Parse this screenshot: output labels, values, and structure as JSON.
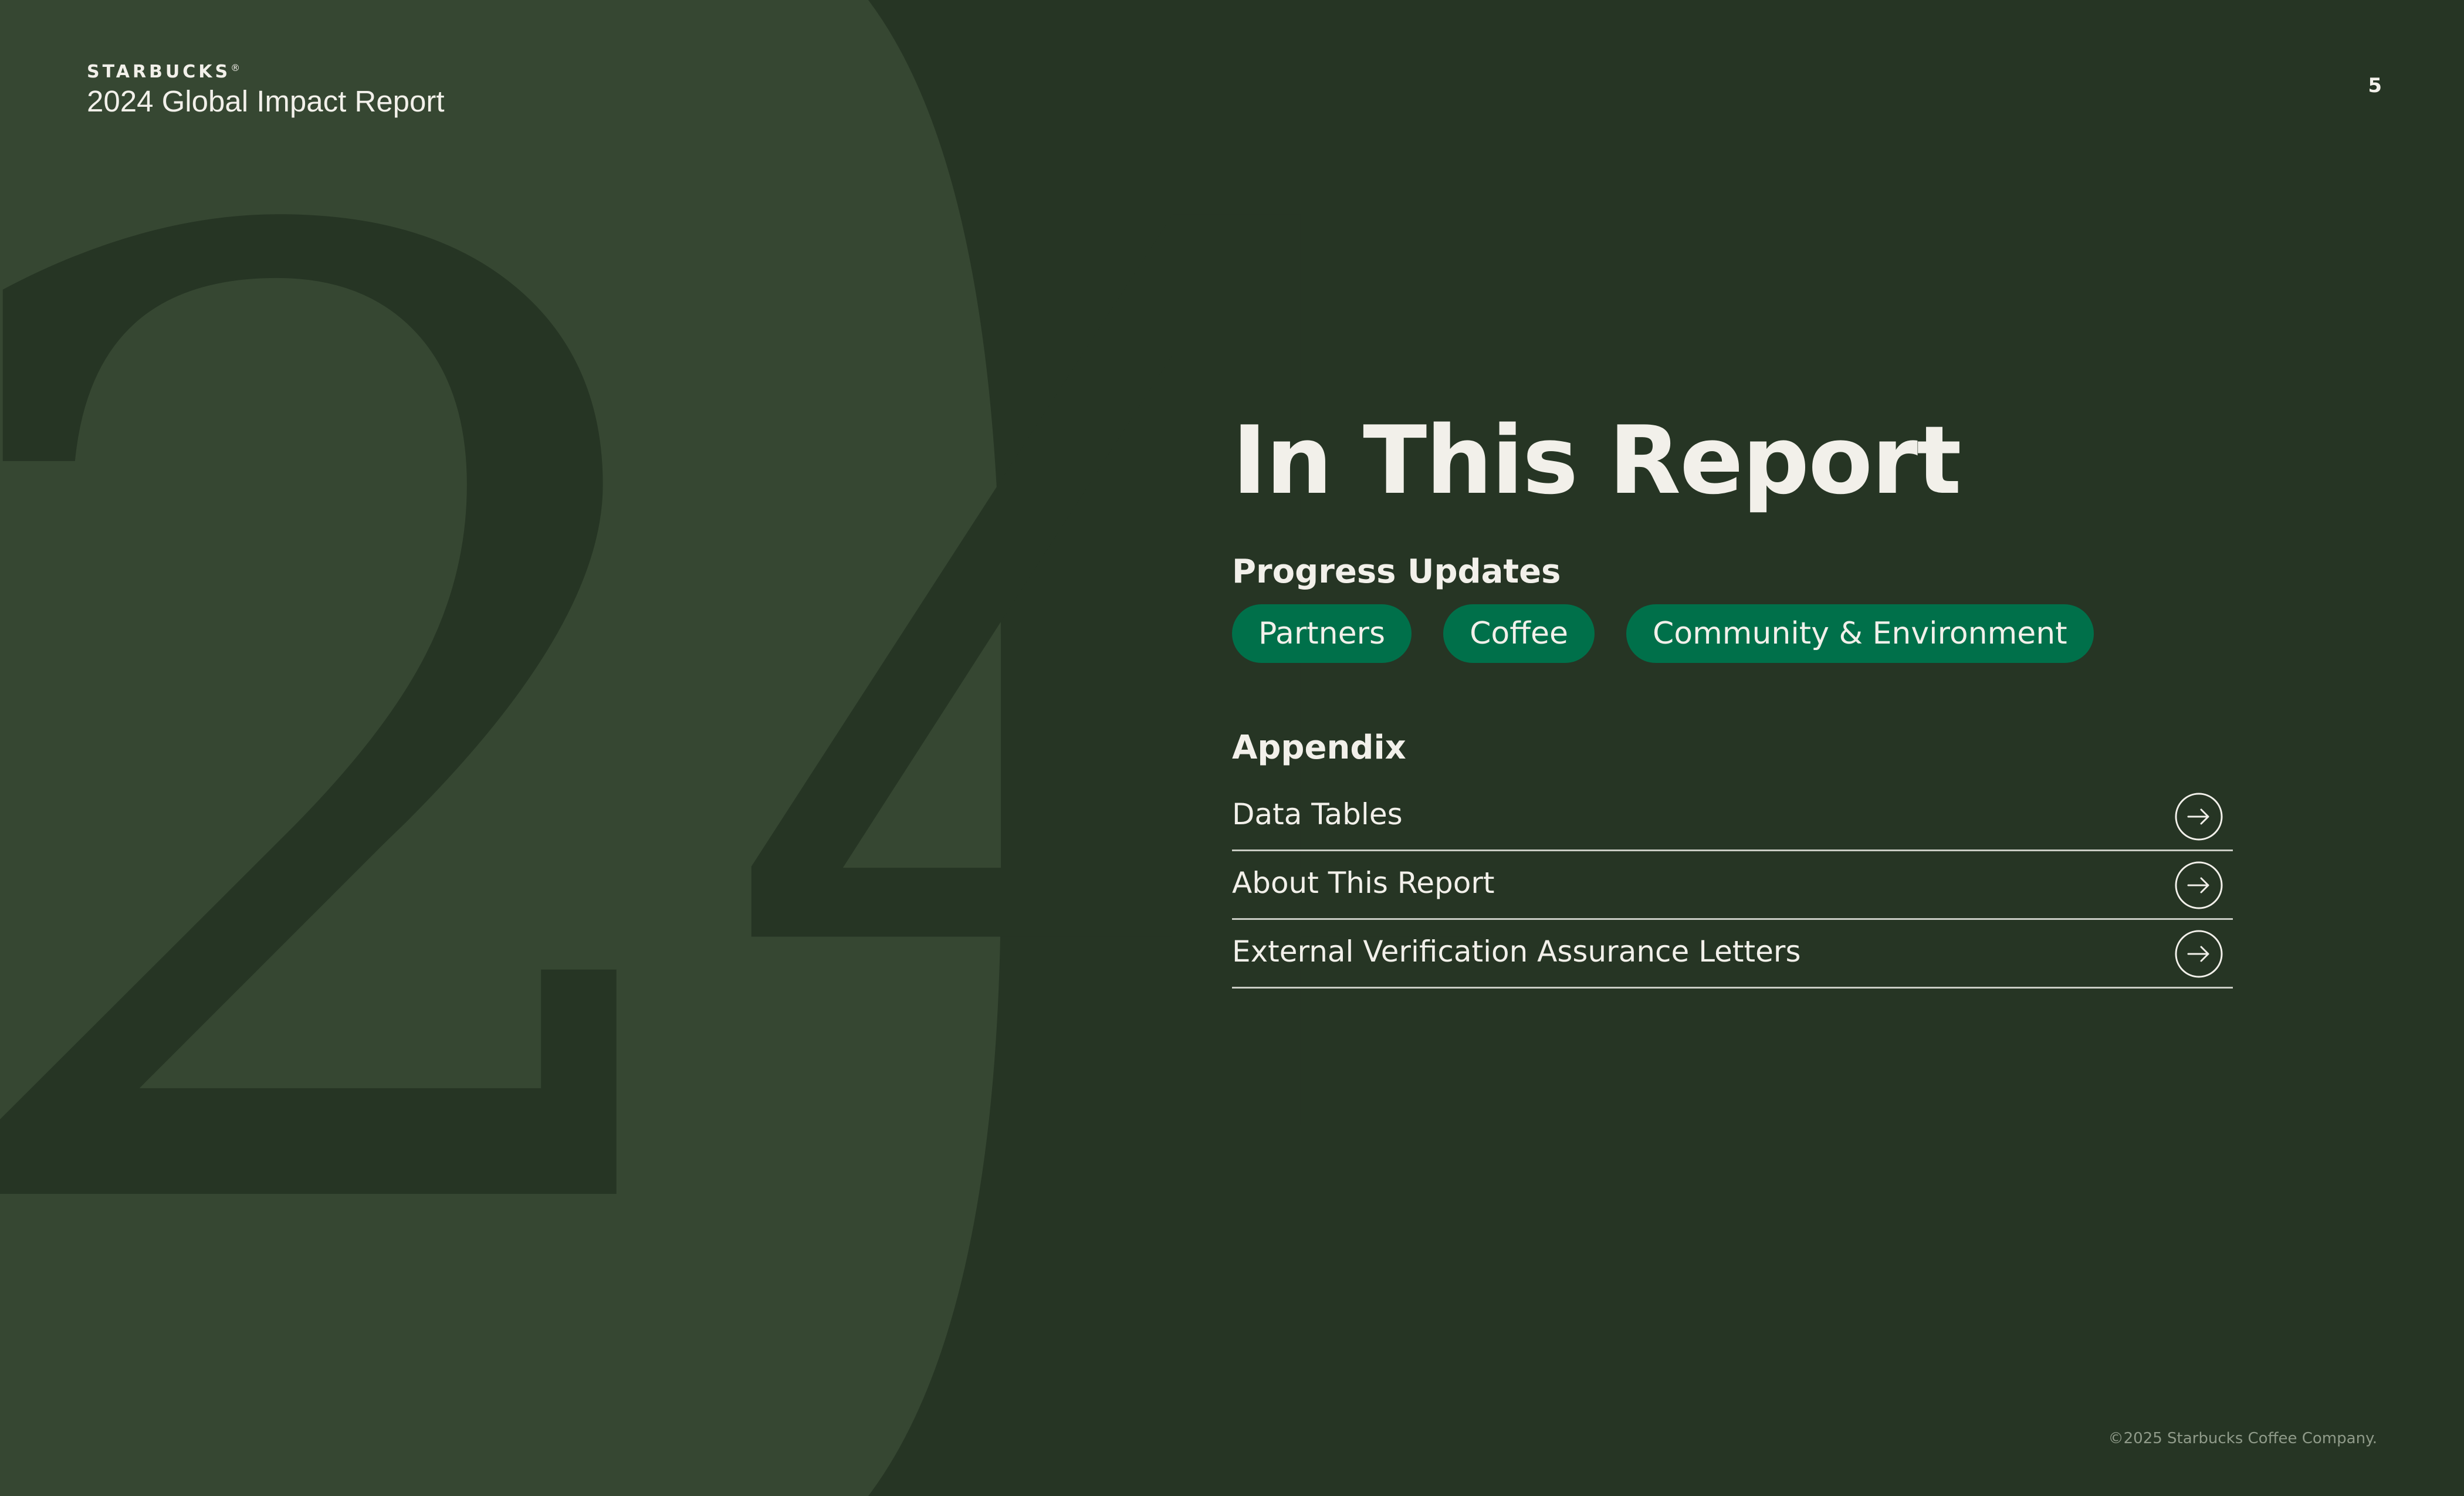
{
  "header": {
    "brand": "STARBUCKS",
    "brand_mark": "®",
    "report_title": "2024 Global Impact Report"
  },
  "page_number": "5",
  "background": {
    "decorative_numerals": "24"
  },
  "main": {
    "heading": "In This Report",
    "progress": {
      "heading": "Progress Updates",
      "pills": [
        "Partners",
        "Coffee",
        "Community & Environment"
      ]
    },
    "appendix": {
      "heading": "Appendix",
      "items": [
        "Data Tables",
        "About This Report",
        "External Verification Assurance Letters"
      ]
    }
  },
  "footer": {
    "copyright": "©2025 Starbucks Coffee Company."
  },
  "colors": {
    "background": "#263524",
    "panel": "#364732",
    "numerals": "#263524",
    "pill": "#00704a",
    "text": "#f2f0ea",
    "divider": "#c9ccc4"
  }
}
